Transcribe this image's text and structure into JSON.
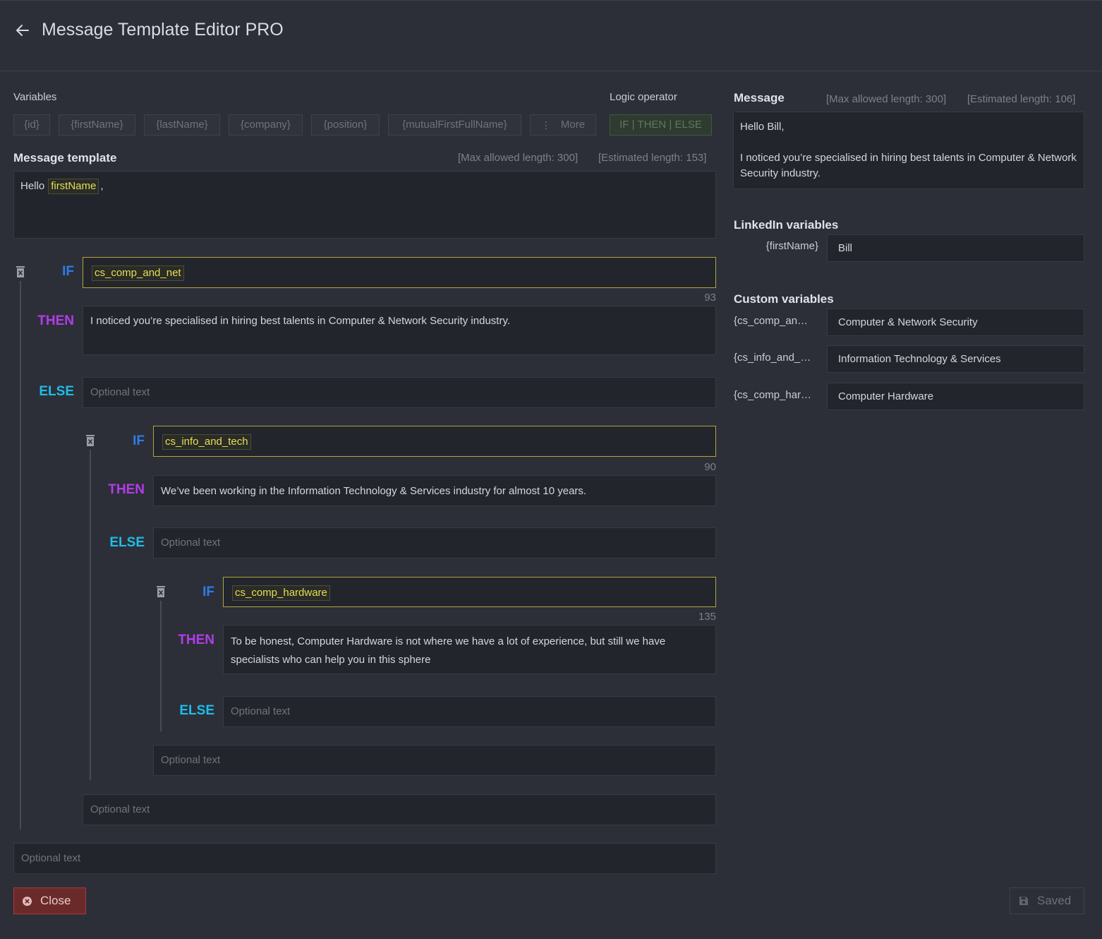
{
  "header": {
    "title": "Message Template Editor PRO"
  },
  "variables": {
    "label": "Variables",
    "chips": [
      "{id}",
      "{firstName}",
      "{lastName}",
      "{company}",
      "{position}",
      "{mutualFirstFullName}"
    ],
    "more_label": "More",
    "logic_label": "Logic operator",
    "logic_chip": "IF | THEN | ELSE"
  },
  "template": {
    "title": "Message template",
    "max_length": "[Max allowed length: 300]",
    "estimated_length": "[Estimated length: 153]",
    "greeting_prefix": "Hello",
    "greeting_variable": "firstName",
    "greeting_suffix": ","
  },
  "logic": {
    "if_keyword": "IF",
    "then_keyword": "THEN",
    "else_keyword": "ELSE",
    "placeholder": "Optional text",
    "blocks": [
      {
        "condition": "cs_comp_and_net",
        "count": "93",
        "then_text": "I noticed you’re specialised in hiring best talents in Computer & Network Security industry."
      },
      {
        "condition": "cs_info_and_tech",
        "count": "90",
        "then_text": "We’ve been working in the Information Technology & Services industry for almost 10  years."
      },
      {
        "condition": "cs_comp_hardware",
        "count": "135",
        "then_text": "To be honest, Computer Hardware is not where we have a lot of experience, but still we have specialists who can help you in this sphere"
      }
    ]
  },
  "message": {
    "title": "Message",
    "max_length": "[Max allowed length: 300]",
    "estimated_length": "[Estimated length: 106]",
    "line1": "Hello Bill,",
    "line2": "I noticed you’re specialised in hiring best talents in Computer & Network Security industry."
  },
  "linkedin_variables": {
    "title": "LinkedIn variables",
    "items": [
      {
        "name": "{firstName}",
        "value": "Bill"
      }
    ]
  },
  "custom_variables": {
    "title": "Custom variables",
    "items": [
      {
        "name": "{cs_comp_an…",
        "value": "Computer & Network Security"
      },
      {
        "name": "{cs_info_and_…",
        "value": "Information Technology & Services"
      },
      {
        "name": "{cs_comp_har…",
        "value": "Computer Hardware"
      }
    ]
  },
  "footer": {
    "close_label": "Close",
    "saved_label": "Saved"
  },
  "colors": {
    "background": "#2c2f38",
    "if_keyword": "#2f7ce8",
    "then_keyword": "#b43ce8",
    "else_keyword": "#1fbde8",
    "variable_tag": "#e4de5a",
    "condition_border": "#b3a63a",
    "close_button": "#6b2a2a"
  },
  "icons": {
    "back": "arrow-left-icon",
    "delete": "trash-icon",
    "more": "vertical-dots-icon",
    "close": "close-circle-icon",
    "save": "floppy-disk-icon"
  }
}
